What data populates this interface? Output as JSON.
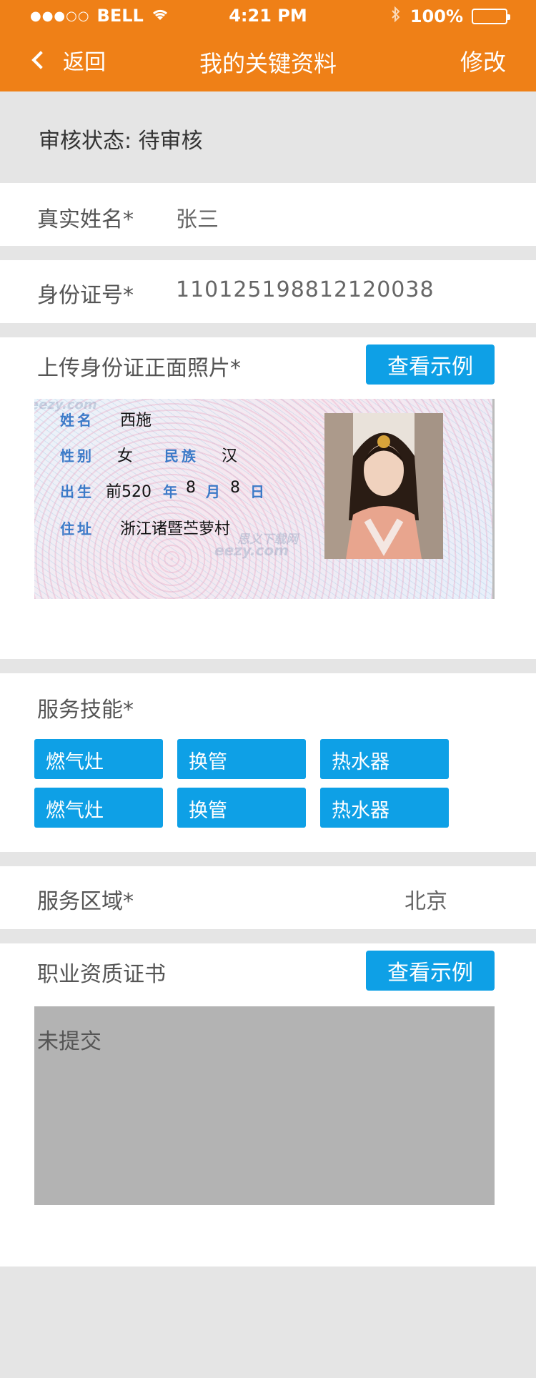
{
  "status_bar": {
    "carrier": "BELL",
    "signal_dots": "●●●○○",
    "time": "4:21 PM",
    "battery_percent": "100%"
  },
  "nav": {
    "back_label": "返回",
    "title": "我的关键资料",
    "edit_label": "修改"
  },
  "review": {
    "label": "审核状态:",
    "value": "待审核"
  },
  "name_row": {
    "label": "真实姓名*",
    "value": "张三"
  },
  "id_row": {
    "label": "身份证号*",
    "value": "110125198812120038"
  },
  "id_upload": {
    "label": "上传身份证正面照片*",
    "example_button": "查看示例",
    "card": {
      "name_label": "姓名",
      "name_value": "西施",
      "gender_label": "性别",
      "gender_value": "女",
      "ethnicity_label": "民族",
      "ethnicity_value": "汉",
      "birth_label": "出生",
      "birth_year": "前520",
      "year_char": "年",
      "birth_month": "8",
      "month_char": "月",
      "birth_day": "8",
      "day_char": "日",
      "address_label": "住址",
      "address_value": "浙江诸暨苎萝村",
      "watermark_top": "eezy.com",
      "watermark_bottom_cn": "思义下载网",
      "watermark_bottom_en": "eezy.com"
    }
  },
  "skills": {
    "label": "服务技能*",
    "tags": [
      "燃气灶",
      "换管",
      "热水器",
      "燃气灶",
      "换管",
      "热水器"
    ]
  },
  "area_row": {
    "label": "服务区域*",
    "value": "北京"
  },
  "certificate": {
    "label": "职业资质证书",
    "example_button": "查看示例",
    "placeholder": "未提交"
  },
  "colors": {
    "header": "#ef8017",
    "accent_blue": "#0ea0e6",
    "background": "#e5e5e5"
  }
}
